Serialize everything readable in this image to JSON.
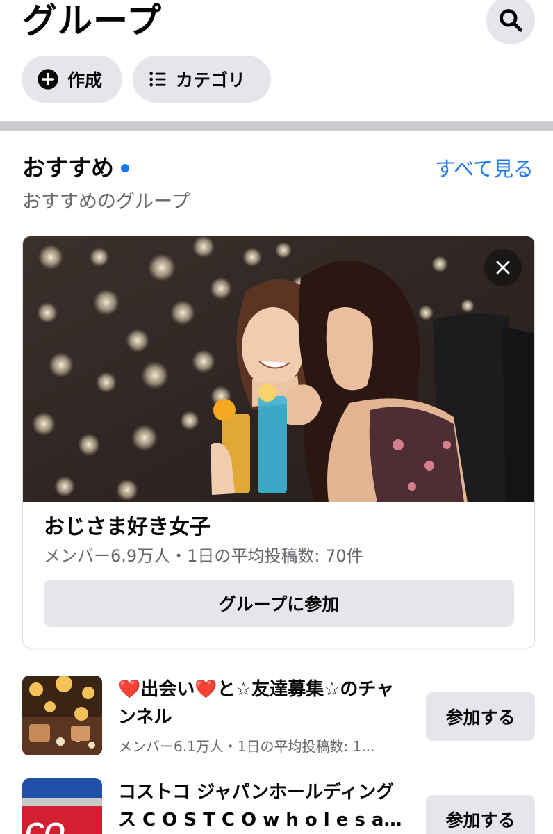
{
  "header": {
    "title": "グループ",
    "search_icon": "search-icon",
    "chips": [
      {
        "label": "作成",
        "icon": "plus-circle-icon"
      },
      {
        "label": "カテゴリ",
        "icon": "list-icon"
      }
    ]
  },
  "recommended": {
    "title": "おすすめ",
    "see_all": "すべて見る",
    "subtitle": "おすすめのグループ",
    "card": {
      "name": "おじさま好き女子",
      "meta": "メンバー6.9万人・1日の平均投稿数: 70件",
      "join_label": "グループに参加",
      "close_icon": "close-icon"
    }
  },
  "list": [
    {
      "title_prefix": "❤️",
      "title_a": "出会い",
      "title_heart": "❤️",
      "title_b": "と☆友達募集☆のチャンネル",
      "meta": "メンバー6.1万人・1日の平均投稿数: 1...",
      "join_label": "参加する"
    },
    {
      "title": "コストコ ジャパンホールディングス C O S T C O w h o l e s a…",
      "join_label": "参加する"
    }
  ],
  "colors": {
    "accent": "#1877f2",
    "chip_bg": "#e4e6eb",
    "divider": "#cacbd1",
    "muted": "#65676b"
  }
}
